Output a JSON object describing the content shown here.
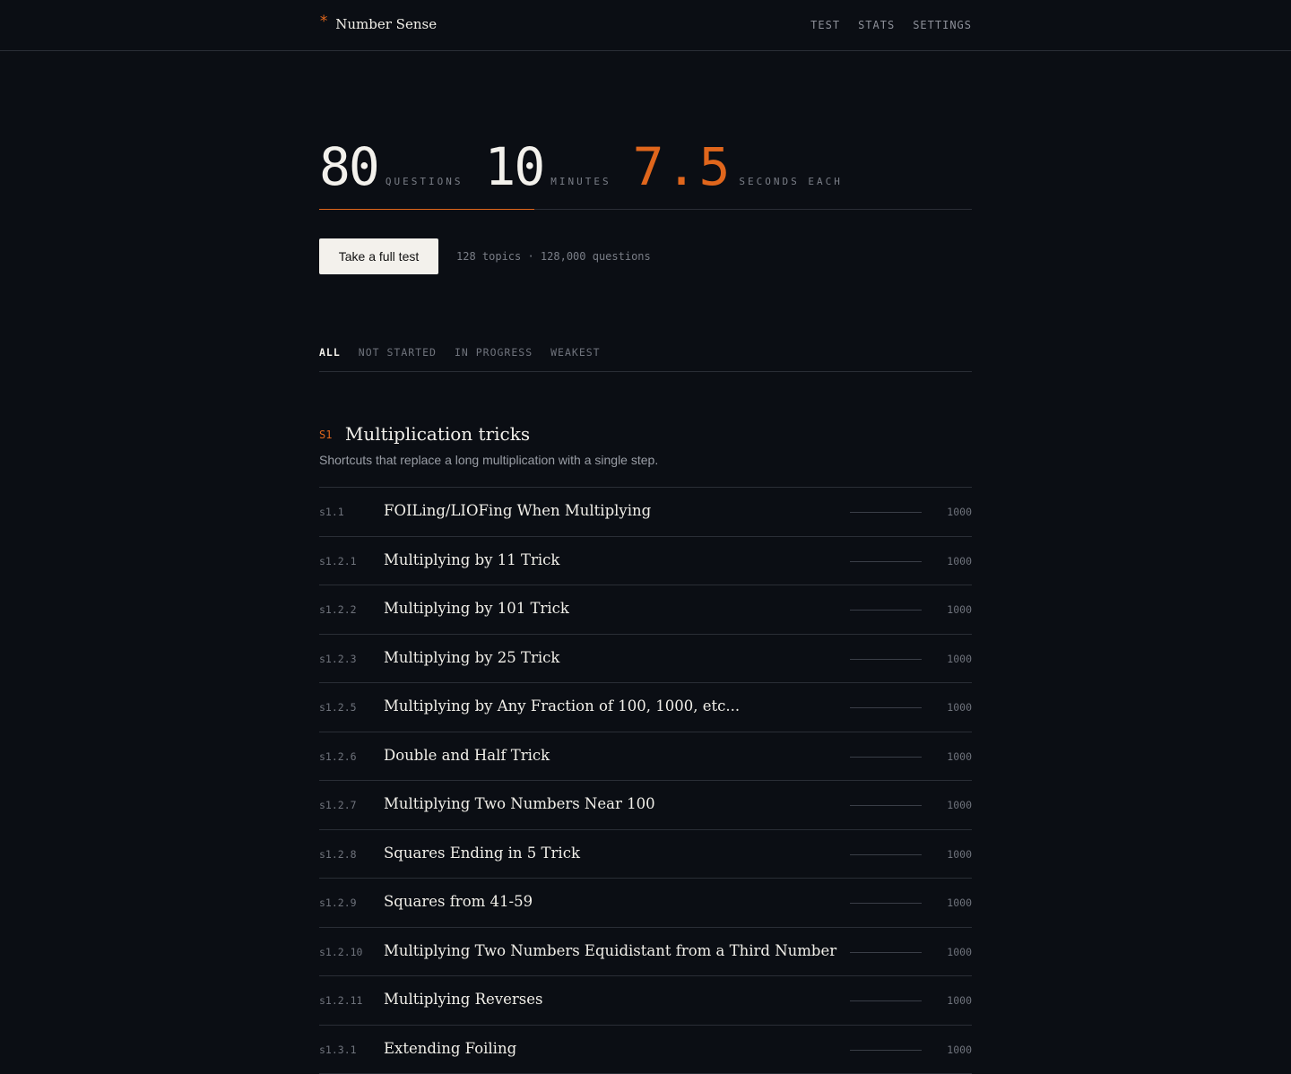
{
  "header": {
    "logo_star": "*",
    "logo_text": "Number Sense",
    "nav": [
      "TEST",
      "STATS",
      "SETTINGS"
    ]
  },
  "stats": {
    "questions": {
      "value": "80",
      "label": "QUESTIONS"
    },
    "minutes": {
      "value": "10",
      "label": "MINUTES"
    },
    "seconds": {
      "value": "7.5",
      "label": "SECONDS EACH"
    }
  },
  "cta": {
    "label": "Take a full test",
    "meta": "128 topics · 128,000 questions"
  },
  "filters": [
    "ALL",
    "NOT STARTED",
    "IN PROGRESS",
    "WEAKEST"
  ],
  "active_filter": "ALL",
  "section": {
    "code": "S1",
    "title": "Multiplication tricks",
    "description": "Shortcuts that replace a long multiplication with a single step."
  },
  "topics": [
    {
      "code": "s1.1",
      "name": "FOILing/LIOFing When Multiplying",
      "count": "1000"
    },
    {
      "code": "s1.2.1",
      "name": "Multiplying by 11 Trick",
      "count": "1000"
    },
    {
      "code": "s1.2.2",
      "name": "Multiplying by 101 Trick",
      "count": "1000"
    },
    {
      "code": "s1.2.3",
      "name": "Multiplying by 25 Trick",
      "count": "1000"
    },
    {
      "code": "s1.2.5",
      "name": "Multiplying by Any Fraction of 100, 1000, etc...",
      "count": "1000"
    },
    {
      "code": "s1.2.6",
      "name": "Double and Half Trick",
      "count": "1000"
    },
    {
      "code": "s1.2.7",
      "name": "Multiplying Two Numbers Near 100",
      "count": "1000"
    },
    {
      "code": "s1.2.8",
      "name": "Squares Ending in 5 Trick",
      "count": "1000"
    },
    {
      "code": "s1.2.9",
      "name": "Squares from 41-59",
      "count": "1000"
    },
    {
      "code": "s1.2.10",
      "name": "Multiplying Two Numbers Equidistant from a Third Number",
      "count": "1000"
    },
    {
      "code": "s1.2.11",
      "name": "Multiplying Reverses",
      "count": "1000"
    },
    {
      "code": "s1.3.1",
      "name": "Extending Foiling",
      "count": "1000"
    }
  ],
  "colors": {
    "background": "#0b0e14",
    "accent": "#e0661c",
    "text": "#f1efe9",
    "muted": "#6f737c"
  }
}
